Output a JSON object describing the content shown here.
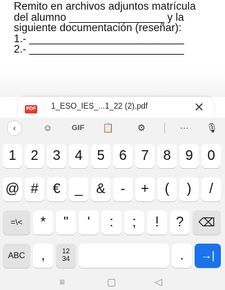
{
  "document": {
    "lines": [
      "Remito en archivos adjuntos matrícula",
      "del alumno ________________ y la",
      "siguiente documentación (reseñar):",
      "1.- __________________________",
      "2.- __________________________"
    ]
  },
  "attachment": {
    "icon_label": "PDF",
    "filename": "1_ESO_IES_...1_22 (2).pdf",
    "close": "✕"
  },
  "keyboard": {
    "toolbar": {
      "back": "‹",
      "emoji": "☺",
      "gif": "GIF",
      "clipboard": "📋",
      "settings": "⚙",
      "more": "···",
      "mic": "🎙"
    },
    "rows": [
      [
        "1",
        "2",
        "3",
        "4",
        "5",
        "6",
        "7",
        "8",
        "9",
        "0"
      ],
      [
        "@",
        "#",
        "€",
        "_",
        "&",
        "-",
        "+",
        "(",
        ")",
        "/"
      ],
      [
        "=\\<",
        "*",
        "\"",
        "'",
        ":",
        ";",
        "!",
        "?",
        "⌫"
      ],
      [
        "ABC",
        ",",
        "12\n34",
        "",
        ".",
        "→|"
      ]
    ]
  },
  "navbar": {
    "recents": "≡",
    "home": "▢",
    "back": "◁"
  }
}
